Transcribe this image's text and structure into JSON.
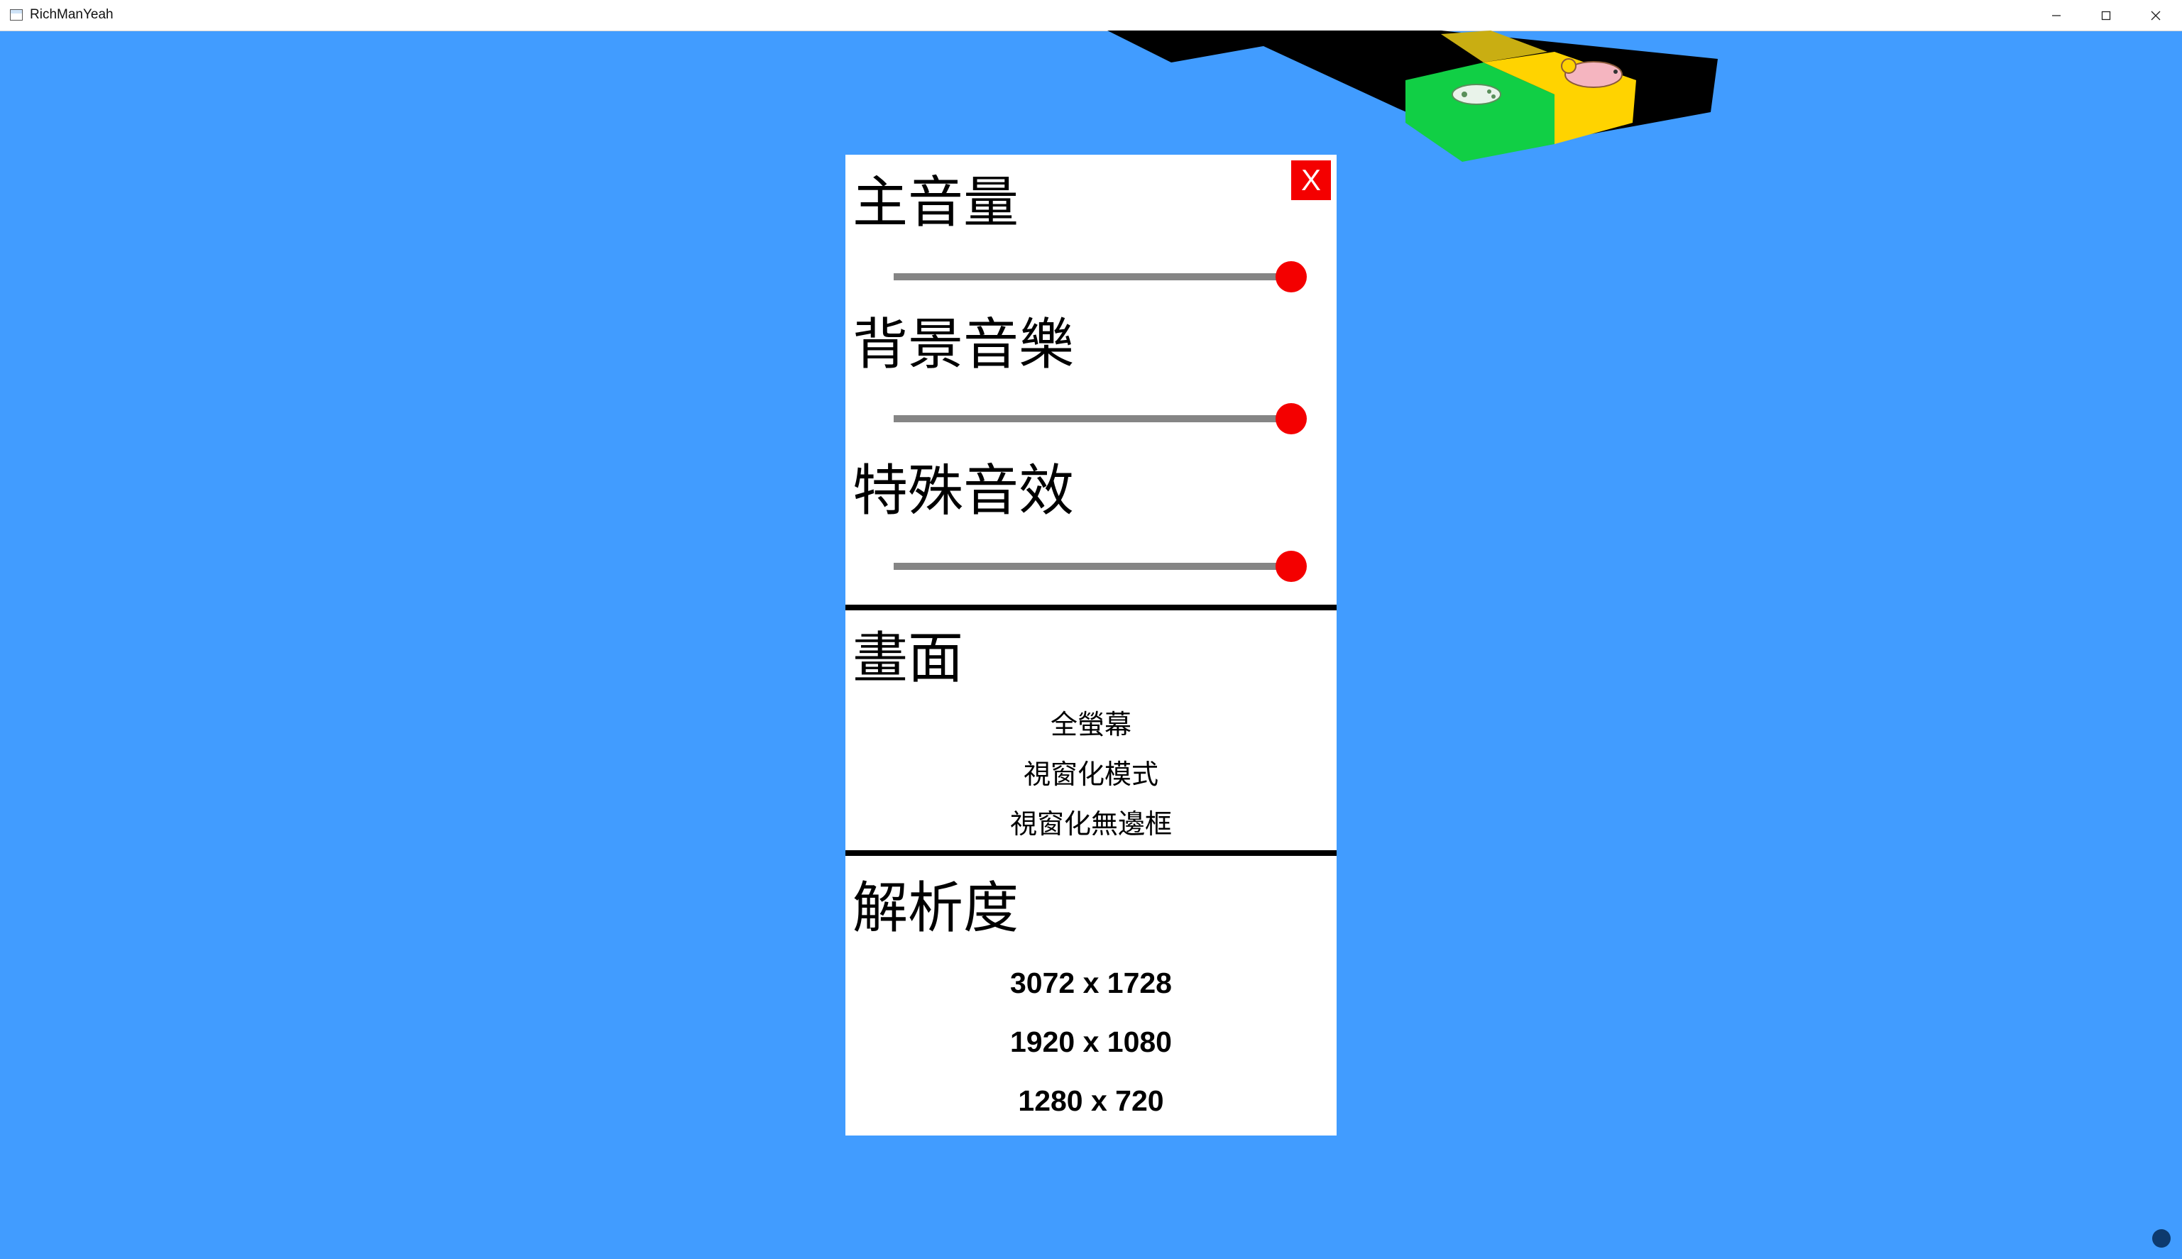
{
  "window": {
    "title": "RichManYeah"
  },
  "settings": {
    "close_label": "X",
    "master_volume": {
      "label": "主音量",
      "level": 1.0
    },
    "bgm_volume": {
      "label": "背景音樂",
      "level": 1.0
    },
    "sfx_volume": {
      "label": "特殊音效",
      "level": 1.0
    },
    "display": {
      "label": "畫面",
      "options": [
        "全螢幕",
        "視窗化模式",
        "視窗化無邊框"
      ]
    },
    "resolution": {
      "label": "解析度",
      "options": [
        "3072 x 1728",
        "1920 x 1080",
        "1280 x 720"
      ]
    }
  },
  "colors": {
    "background": "#419cff",
    "slider_thumb": "#f40000",
    "slider_track": "#858585",
    "close_button": "#f40000",
    "tile_green": "#11cf45",
    "tile_yellow": "#ffd300",
    "board_black": "#000000"
  },
  "icons": {
    "board_tile_left": "gamepad-icon",
    "board_tile_right": "piggy-bank-icon"
  }
}
